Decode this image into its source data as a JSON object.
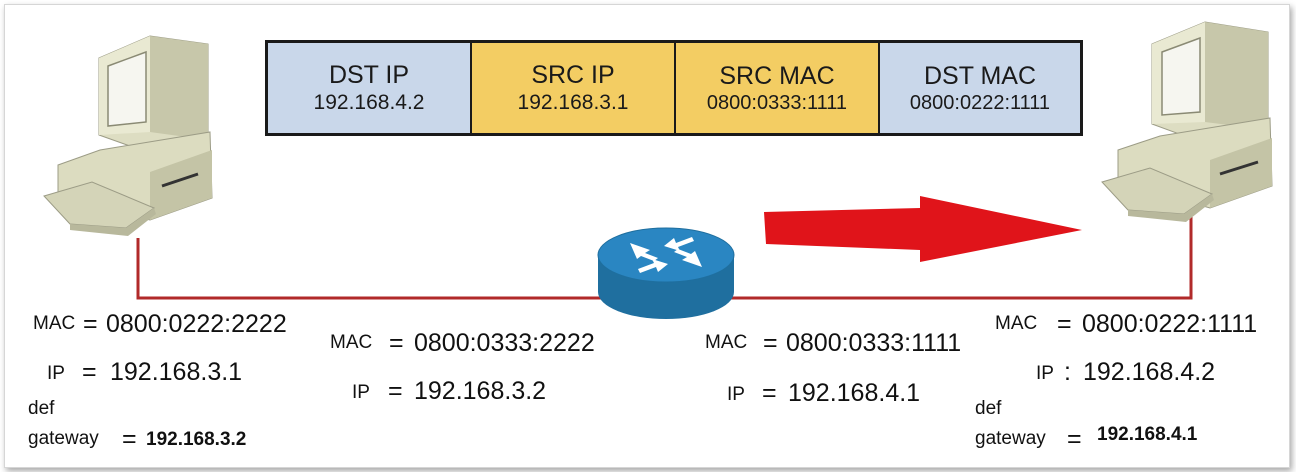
{
  "packet": [
    {
      "label": "DST IP",
      "value": "192.168.4.2",
      "color": "#c9d7ea"
    },
    {
      "label": "SRC IP",
      "value": "192.168.3.1",
      "color": "#f3cd63"
    },
    {
      "label": "SRC MAC",
      "value": "0800:0333:1111",
      "color": "#f3cd63"
    },
    {
      "label": "DST MAC",
      "value": "0800:0222:1111",
      "color": "#c9d7ea"
    }
  ],
  "colors": {
    "link": "#b12a2a",
    "arrow": "#e0141a",
    "router": "#2a86c2"
  },
  "left_host": {
    "mac_label": "MAC",
    "mac_eq": "=",
    "mac": "0800:0222:2222",
    "ip_label": "IP",
    "ip_eq": "=",
    "ip": "192.168.3.1",
    "gw_label_1": "def",
    "gw_label_2": "gateway",
    "gw_eq": "=",
    "gw": "192.168.3.2"
  },
  "router_left": {
    "mac_label": "MAC",
    "mac_eq": "=",
    "mac": "0800:0333:2222",
    "ip_label": "IP",
    "ip_eq": "=",
    "ip": "192.168.3.2"
  },
  "router_right": {
    "mac_label": "MAC",
    "mac_eq": "=",
    "mac": "0800:0333:1111",
    "ip_label": "IP",
    "ip_eq": "=",
    "ip": "192.168.4.1"
  },
  "right_host": {
    "mac_label": "MAC",
    "mac_eq": "=",
    "mac": "0800:0222:1111",
    "ip_label": "IP",
    "ip_eq": ":",
    "ip": "192.168.4.2",
    "gw_label_1": "def",
    "gw_label_2": "gateway",
    "gw_eq": "=",
    "gw": "192.168.4.1"
  }
}
